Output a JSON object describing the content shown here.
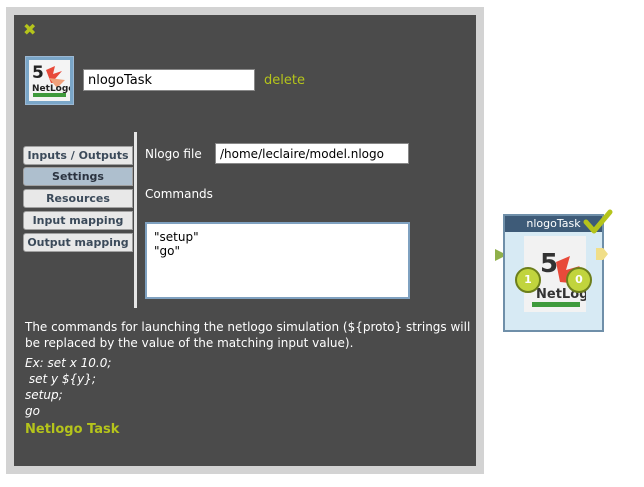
{
  "window": {
    "close_icon": "close-icon",
    "task_icon": "netlogo-5-logo",
    "task_name_value": "nlogoTask",
    "delete_label": "delete"
  },
  "tabs": [
    {
      "label": "Inputs / Outputs",
      "active": false
    },
    {
      "label": "Settings",
      "active": true
    },
    {
      "label": "Resources",
      "active": false
    },
    {
      "label": "Input mapping",
      "active": false
    },
    {
      "label": "Output mapping",
      "active": false
    }
  ],
  "settings": {
    "nlogo_file_label": "Nlogo file",
    "nlogo_file_value": "/home/leclaire/model.nlogo",
    "commands_label": "Commands",
    "commands_value": "\"setup\"\n\"go\""
  },
  "help": {
    "description": "The commands for launching the netlogo simulation (${proto} strings will be replaced by the value of the matching input value).",
    "example_lines": [
      "Ex: set x 10.0;",
      " set y ${y};",
      "setup;",
      "go"
    ],
    "title": "Netlogo Task"
  },
  "capsule": {
    "title": "nlogoTask",
    "input_slot_count": "1",
    "output_slot_count": "0",
    "status_icon": "checkmark-icon"
  },
  "colors": {
    "panel_bg": "#4b4b4b",
    "accent": "#b5c41b",
    "capsule_header": "#3e5b78",
    "capsule_body": "#d7eaf4"
  }
}
